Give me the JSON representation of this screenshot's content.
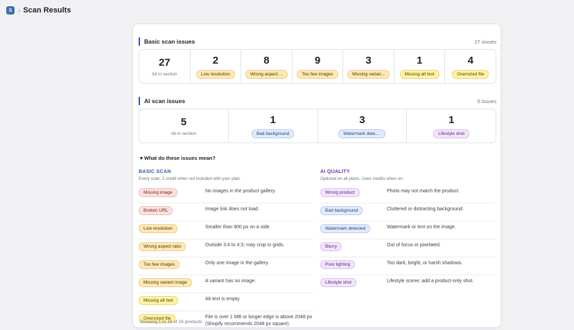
{
  "header": {
    "app_icon_letter": "S",
    "title": "Scan Results"
  },
  "basic_section": {
    "title": "Basic scan issues",
    "count": "27 issues",
    "stats": [
      {
        "value": "27",
        "label": "All in section",
        "style": "plain"
      },
      {
        "value": "2",
        "label": "Low resolution",
        "style": "warn"
      },
      {
        "value": "8",
        "label": "Wrong aspect ...",
        "style": "warn"
      },
      {
        "value": "9",
        "label": "Too few images",
        "style": "warn"
      },
      {
        "value": "3",
        "label": "Missing varian...",
        "style": "warn"
      },
      {
        "value": "1",
        "label": "Missing alt text",
        "style": "alt"
      },
      {
        "value": "4",
        "label": "Oversized file",
        "style": "alt"
      }
    ]
  },
  "ai_section": {
    "title": "AI scan issues",
    "count": "5 issues",
    "stats": [
      {
        "value": "5",
        "label": "All in section",
        "style": "plain"
      },
      {
        "value": "1",
        "label": "Bad background",
        "style": "blue"
      },
      {
        "value": "3",
        "label": "Watermark detected",
        "style": "blue"
      },
      {
        "value": "1",
        "label": "Lifestyle shot",
        "style": "purple"
      }
    ]
  },
  "explain": {
    "toggle": "▾ What do these issues mean?"
  },
  "basic_legend": {
    "heading": "BASIC SCAN",
    "subtitle": "Every scan. 1 credit when not included with your plan.",
    "heading_color": "#2c5aa0",
    "rows": [
      {
        "pill": "Missing image",
        "style": "red",
        "desc": "No images in the product gallery."
      },
      {
        "pill": "Broken URL",
        "style": "red",
        "desc": "Image link does not load."
      },
      {
        "pill": "Low resolution",
        "style": "warn",
        "desc": "Smaller than 800 px on a side."
      },
      {
        "pill": "Wrong aspect ratio",
        "style": "warn",
        "desc": "Outside 3:4 to 4:3; may crop in grids."
      },
      {
        "pill": "Too few images",
        "style": "warn",
        "desc": "Only one image in the gallery."
      },
      {
        "pill": "Missing variant image",
        "style": "warn",
        "desc": "A variant has no image."
      },
      {
        "pill": "Missing alt text",
        "style": "alt",
        "desc": "Alt text is empty."
      },
      {
        "pill": "Oversized file",
        "style": "alt",
        "desc": "File is over 1 MB or longer edge is above 2048 px (Shopify recommends 2048 px square)."
      }
    ]
  },
  "ai_legend": {
    "heading": "AI QUALITY",
    "subtitle": "Optional on all plans. Uses credits when on.",
    "heading_color": "#6f2da8",
    "rows": [
      {
        "pill": "Wrong product",
        "style": "purple",
        "desc": "Photo may not match the product."
      },
      {
        "pill": "Bad background",
        "style": "blue",
        "desc": "Cluttered or distracting background."
      },
      {
        "pill": "Watermark detected",
        "style": "blue",
        "desc": "Watermark or text on the image."
      },
      {
        "pill": "Blurry",
        "style": "purple",
        "desc": "Out of focus or pixelated."
      },
      {
        "pill": "Poor lighting",
        "style": "purple",
        "desc": "Too dark, bright, or harsh shadows."
      },
      {
        "pill": "Lifestyle shot",
        "style": "purple",
        "desc": "Lifestyle scene; add a product-only shot."
      }
    ]
  },
  "footer": {
    "text": "Showing 1 to 16 of 16 products"
  }
}
